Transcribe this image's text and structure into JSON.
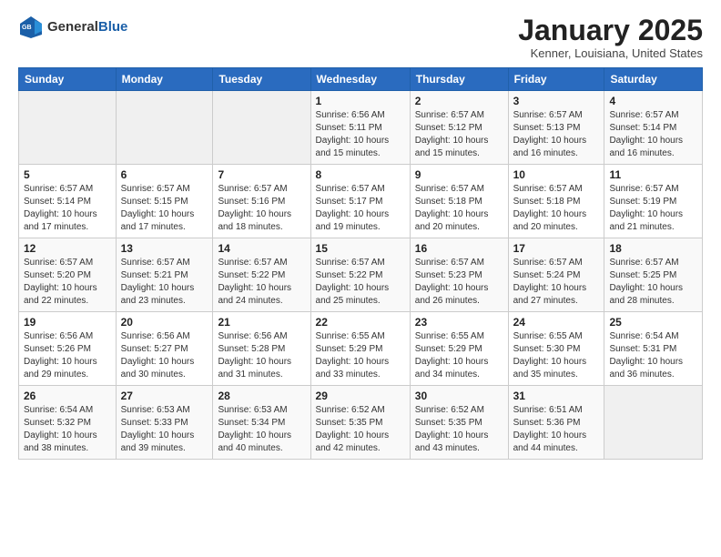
{
  "header": {
    "logo": {
      "general": "General",
      "blue": "Blue"
    },
    "title": "January 2025",
    "location": "Kenner, Louisiana, United States"
  },
  "weekdays": [
    "Sunday",
    "Monday",
    "Tuesday",
    "Wednesday",
    "Thursday",
    "Friday",
    "Saturday"
  ],
  "weeks": [
    [
      {
        "day": "",
        "info": ""
      },
      {
        "day": "",
        "info": ""
      },
      {
        "day": "",
        "info": ""
      },
      {
        "day": "1",
        "info": "Sunrise: 6:56 AM\nSunset: 5:11 PM\nDaylight: 10 hours\nand 15 minutes."
      },
      {
        "day": "2",
        "info": "Sunrise: 6:57 AM\nSunset: 5:12 PM\nDaylight: 10 hours\nand 15 minutes."
      },
      {
        "day": "3",
        "info": "Sunrise: 6:57 AM\nSunset: 5:13 PM\nDaylight: 10 hours\nand 16 minutes."
      },
      {
        "day": "4",
        "info": "Sunrise: 6:57 AM\nSunset: 5:14 PM\nDaylight: 10 hours\nand 16 minutes."
      }
    ],
    [
      {
        "day": "5",
        "info": "Sunrise: 6:57 AM\nSunset: 5:14 PM\nDaylight: 10 hours\nand 17 minutes."
      },
      {
        "day": "6",
        "info": "Sunrise: 6:57 AM\nSunset: 5:15 PM\nDaylight: 10 hours\nand 17 minutes."
      },
      {
        "day": "7",
        "info": "Sunrise: 6:57 AM\nSunset: 5:16 PM\nDaylight: 10 hours\nand 18 minutes."
      },
      {
        "day": "8",
        "info": "Sunrise: 6:57 AM\nSunset: 5:17 PM\nDaylight: 10 hours\nand 19 minutes."
      },
      {
        "day": "9",
        "info": "Sunrise: 6:57 AM\nSunset: 5:18 PM\nDaylight: 10 hours\nand 20 minutes."
      },
      {
        "day": "10",
        "info": "Sunrise: 6:57 AM\nSunset: 5:18 PM\nDaylight: 10 hours\nand 20 minutes."
      },
      {
        "day": "11",
        "info": "Sunrise: 6:57 AM\nSunset: 5:19 PM\nDaylight: 10 hours\nand 21 minutes."
      }
    ],
    [
      {
        "day": "12",
        "info": "Sunrise: 6:57 AM\nSunset: 5:20 PM\nDaylight: 10 hours\nand 22 minutes."
      },
      {
        "day": "13",
        "info": "Sunrise: 6:57 AM\nSunset: 5:21 PM\nDaylight: 10 hours\nand 23 minutes."
      },
      {
        "day": "14",
        "info": "Sunrise: 6:57 AM\nSunset: 5:22 PM\nDaylight: 10 hours\nand 24 minutes."
      },
      {
        "day": "15",
        "info": "Sunrise: 6:57 AM\nSunset: 5:22 PM\nDaylight: 10 hours\nand 25 minutes."
      },
      {
        "day": "16",
        "info": "Sunrise: 6:57 AM\nSunset: 5:23 PM\nDaylight: 10 hours\nand 26 minutes."
      },
      {
        "day": "17",
        "info": "Sunrise: 6:57 AM\nSunset: 5:24 PM\nDaylight: 10 hours\nand 27 minutes."
      },
      {
        "day": "18",
        "info": "Sunrise: 6:57 AM\nSunset: 5:25 PM\nDaylight: 10 hours\nand 28 minutes."
      }
    ],
    [
      {
        "day": "19",
        "info": "Sunrise: 6:56 AM\nSunset: 5:26 PM\nDaylight: 10 hours\nand 29 minutes."
      },
      {
        "day": "20",
        "info": "Sunrise: 6:56 AM\nSunset: 5:27 PM\nDaylight: 10 hours\nand 30 minutes."
      },
      {
        "day": "21",
        "info": "Sunrise: 6:56 AM\nSunset: 5:28 PM\nDaylight: 10 hours\nand 31 minutes."
      },
      {
        "day": "22",
        "info": "Sunrise: 6:55 AM\nSunset: 5:29 PM\nDaylight: 10 hours\nand 33 minutes."
      },
      {
        "day": "23",
        "info": "Sunrise: 6:55 AM\nSunset: 5:29 PM\nDaylight: 10 hours\nand 34 minutes."
      },
      {
        "day": "24",
        "info": "Sunrise: 6:55 AM\nSunset: 5:30 PM\nDaylight: 10 hours\nand 35 minutes."
      },
      {
        "day": "25",
        "info": "Sunrise: 6:54 AM\nSunset: 5:31 PM\nDaylight: 10 hours\nand 36 minutes."
      }
    ],
    [
      {
        "day": "26",
        "info": "Sunrise: 6:54 AM\nSunset: 5:32 PM\nDaylight: 10 hours\nand 38 minutes."
      },
      {
        "day": "27",
        "info": "Sunrise: 6:53 AM\nSunset: 5:33 PM\nDaylight: 10 hours\nand 39 minutes."
      },
      {
        "day": "28",
        "info": "Sunrise: 6:53 AM\nSunset: 5:34 PM\nDaylight: 10 hours\nand 40 minutes."
      },
      {
        "day": "29",
        "info": "Sunrise: 6:52 AM\nSunset: 5:35 PM\nDaylight: 10 hours\nand 42 minutes."
      },
      {
        "day": "30",
        "info": "Sunrise: 6:52 AM\nSunset: 5:35 PM\nDaylight: 10 hours\nand 43 minutes."
      },
      {
        "day": "31",
        "info": "Sunrise: 6:51 AM\nSunset: 5:36 PM\nDaylight: 10 hours\nand 44 minutes."
      },
      {
        "day": "",
        "info": ""
      }
    ]
  ]
}
